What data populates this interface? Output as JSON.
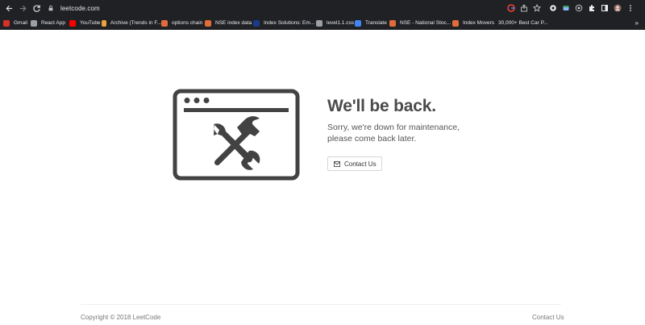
{
  "browser": {
    "url": "leetcode.com",
    "bookmarks": [
      {
        "label": "Gmail",
        "color": "#d93025",
        "icon": "gmail-icon"
      },
      {
        "label": "React App",
        "color": "#9aa0a6",
        "icon": "globe-icon"
      },
      {
        "label": "YouTube",
        "color": "#ff0000",
        "icon": "youtube-icon"
      },
      {
        "label": "Archive (Trends in F...",
        "color": "#e8a33d",
        "icon": "archive-icon"
      },
      {
        "label": "options chain",
        "color": "#e06c3c",
        "icon": "nse-icon"
      },
      {
        "label": "NSE index data",
        "color": "#e06c3c",
        "icon": "nse-icon"
      },
      {
        "label": "Index Solutions: Em...",
        "color": "#1a3a8a",
        "icon": "msci-icon"
      },
      {
        "label": "level1.1.css",
        "color": "#9aa0a6",
        "icon": "globe-icon"
      },
      {
        "label": "Translate",
        "color": "#4285f4",
        "icon": "translate-icon"
      },
      {
        "label": "NSE - National Stoc...",
        "color": "#e06c3c",
        "icon": "nse-icon"
      },
      {
        "label": "Index Movers",
        "color": "#e06c3c",
        "icon": "nse-icon"
      },
      {
        "label": "30,000+ Best Car P...",
        "color": "#2bb5a0",
        "icon": "unsplash-icon"
      }
    ],
    "more": "»"
  },
  "page": {
    "title": "We'll be back.",
    "subtitle_line1": "Sorry, we're down for maintenance,",
    "subtitle_line2": "please come back later.",
    "contact_button": "Contact Us",
    "copyright": "Copyright © 2018 LeetCode",
    "footer_contact": "Contact Us"
  },
  "colors": {
    "chrome": "#202124",
    "illustration": "#424242",
    "title": "#4a4a4a"
  }
}
